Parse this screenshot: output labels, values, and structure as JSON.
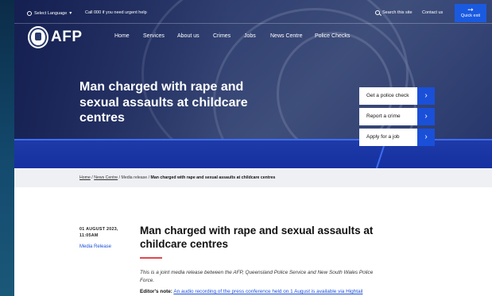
{
  "topbar": {
    "language_label": "Select Language",
    "call_text": "Call 000 if you need urgent help",
    "search_label": "Search this site",
    "contact_label": "Contact us",
    "quick_exit_label": "Quick exit"
  },
  "logo": {
    "text": "AFP"
  },
  "nav": {
    "items": [
      {
        "label": "Home"
      },
      {
        "label": "Services"
      },
      {
        "label": "About us"
      },
      {
        "label": "Crimes"
      },
      {
        "label": "Jobs"
      },
      {
        "label": "News Centre"
      },
      {
        "label": "Police Checks"
      }
    ]
  },
  "hero": {
    "headline": "Man charged with rape and sexual assaults at childcare centres",
    "actions": [
      {
        "label": "Get a police check"
      },
      {
        "label": "Report a crime"
      },
      {
        "label": "Apply for a job"
      }
    ]
  },
  "breadcrumb": {
    "items": [
      {
        "label": "Home"
      },
      {
        "label": "News Centre"
      },
      {
        "label": "Media release"
      }
    ],
    "current": "Man charged with rape and sexual assaults at childcare centres",
    "separator": "/"
  },
  "article": {
    "date": "01 AUGUST 2023,",
    "time": "11:05AM",
    "category": "Media Release",
    "title": "Man charged with rape and sexual assaults at childcare centres",
    "intro": "This is a joint media release between the AFP, Queensland Police Service and New South Wales Police Force.",
    "editor_label": "Editor's note:",
    "editor_link": "An audio recording of the press conference held on 1 August is available via Hightail"
  },
  "colors": {
    "accent": "#1a4fd8",
    "quick_exit": "#1a5ae0",
    "highlight": "#e2474d",
    "hero_band": "#1e3ba8"
  },
  "icons": [
    "globe-icon",
    "chevron-down-icon",
    "search-icon",
    "running-person-icon",
    "afp-crest-icon",
    "chevron-right-icon"
  ]
}
